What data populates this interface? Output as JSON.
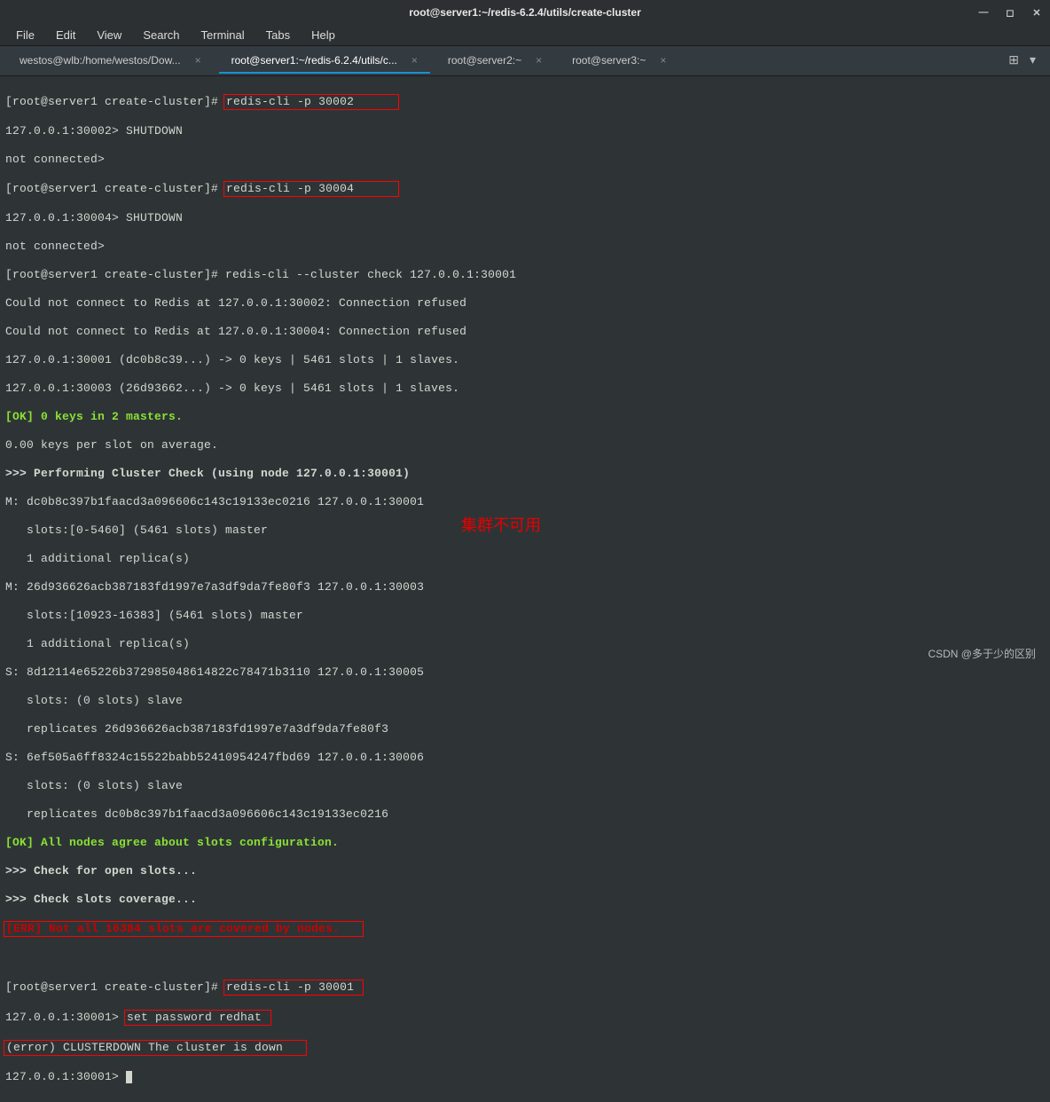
{
  "titlebar": {
    "title": "root@server1:~/redis-6.2.4/utils/create-cluster"
  },
  "menubar": {
    "file": "File",
    "edit": "Edit",
    "view": "View",
    "search": "Search",
    "terminal": "Terminal",
    "tabs": "Tabs",
    "help": "Help"
  },
  "tabs": [
    {
      "label": "westos@wlb:/home/westos/Dow...",
      "active": false
    },
    {
      "label": "root@server1:~/redis-6.2.4/utils/c...",
      "active": true
    },
    {
      "label": "root@server2:~",
      "active": false
    },
    {
      "label": "root@server3:~",
      "active": false
    }
  ],
  "lines": {
    "l1_prompt": "[root@server1 create-cluster]# ",
    "l1_cmd": "redis-cli -p 30002",
    "l2": "127.0.0.1:30002> SHUTDOWN",
    "l3": "not connected>",
    "l4_prompt": "[root@server1 create-cluster]# ",
    "l4_cmd": "redis-cli -p 30004",
    "l5": "127.0.0.1:30004> SHUTDOWN",
    "l6": "not connected>",
    "l7": "[root@server1 create-cluster]# redis-cli --cluster check 127.0.0.1:30001",
    "l8": "Could not connect to Redis at 127.0.0.1:30002: Connection refused",
    "l9": "Could not connect to Redis at 127.0.0.1:30004: Connection refused",
    "l10": "127.0.0.1:30001 (dc0b8c39...) -> 0 keys | 5461 slots | 1 slaves.",
    "l11": "127.0.0.1:30003 (26d93662...) -> 0 keys | 5461 slots | 1 slaves.",
    "l12": "[OK] 0 keys in 2 masters.",
    "l13": "0.00 keys per slot on average.",
    "l14": ">>> Performing Cluster Check (using node 127.0.0.1:30001)",
    "l15": "M: dc0b8c397b1faacd3a096606c143c19133ec0216 127.0.0.1:30001",
    "l16": "   slots:[0-5460] (5461 slots) master",
    "l17": "   1 additional replica(s)",
    "l18": "M: 26d936626acb387183fd1997e7a3df9da7fe80f3 127.0.0.1:30003",
    "l19": "   slots:[10923-16383] (5461 slots) master",
    "l20": "   1 additional replica(s)",
    "l21": "S: 8d12114e65226b372985048614822c78471b3110 127.0.0.1:30005",
    "l22": "   slots: (0 slots) slave",
    "l23": "   replicates 26d936626acb387183fd1997e7a3df9da7fe80f3",
    "l24": "S: 6ef505a6ff8324c15522babb52410954247fbd69 127.0.0.1:30006",
    "l25": "   slots: (0 slots) slave",
    "l26": "   replicates dc0b8c397b1faacd3a096606c143c19133ec0216",
    "l27": "[OK] All nodes agree about slots configuration.",
    "l28": ">>> Check for open slots...",
    "l29": ">>> Check slots coverage...",
    "l30": "[ERR] Not all 16384 slots are covered by nodes.",
    "l31_prompt": "[root@server1 create-cluster]# ",
    "l31_cmd": "redis-cli -p 30001",
    "l32a": "127.0.0.1:30001> ",
    "l32b": "set password redhat",
    "l33": "(error) CLUSTERDOWN The cluster is down",
    "l34": "127.0.0.1:30001> "
  },
  "annotation": "集群不可用",
  "watermark": "CSDN @多于少的区别",
  "icons": {
    "close": "✕",
    "minimize": "—",
    "maximize": "◻",
    "newtab": "⊞",
    "dropdown": "▾",
    "tabclose": "×"
  }
}
